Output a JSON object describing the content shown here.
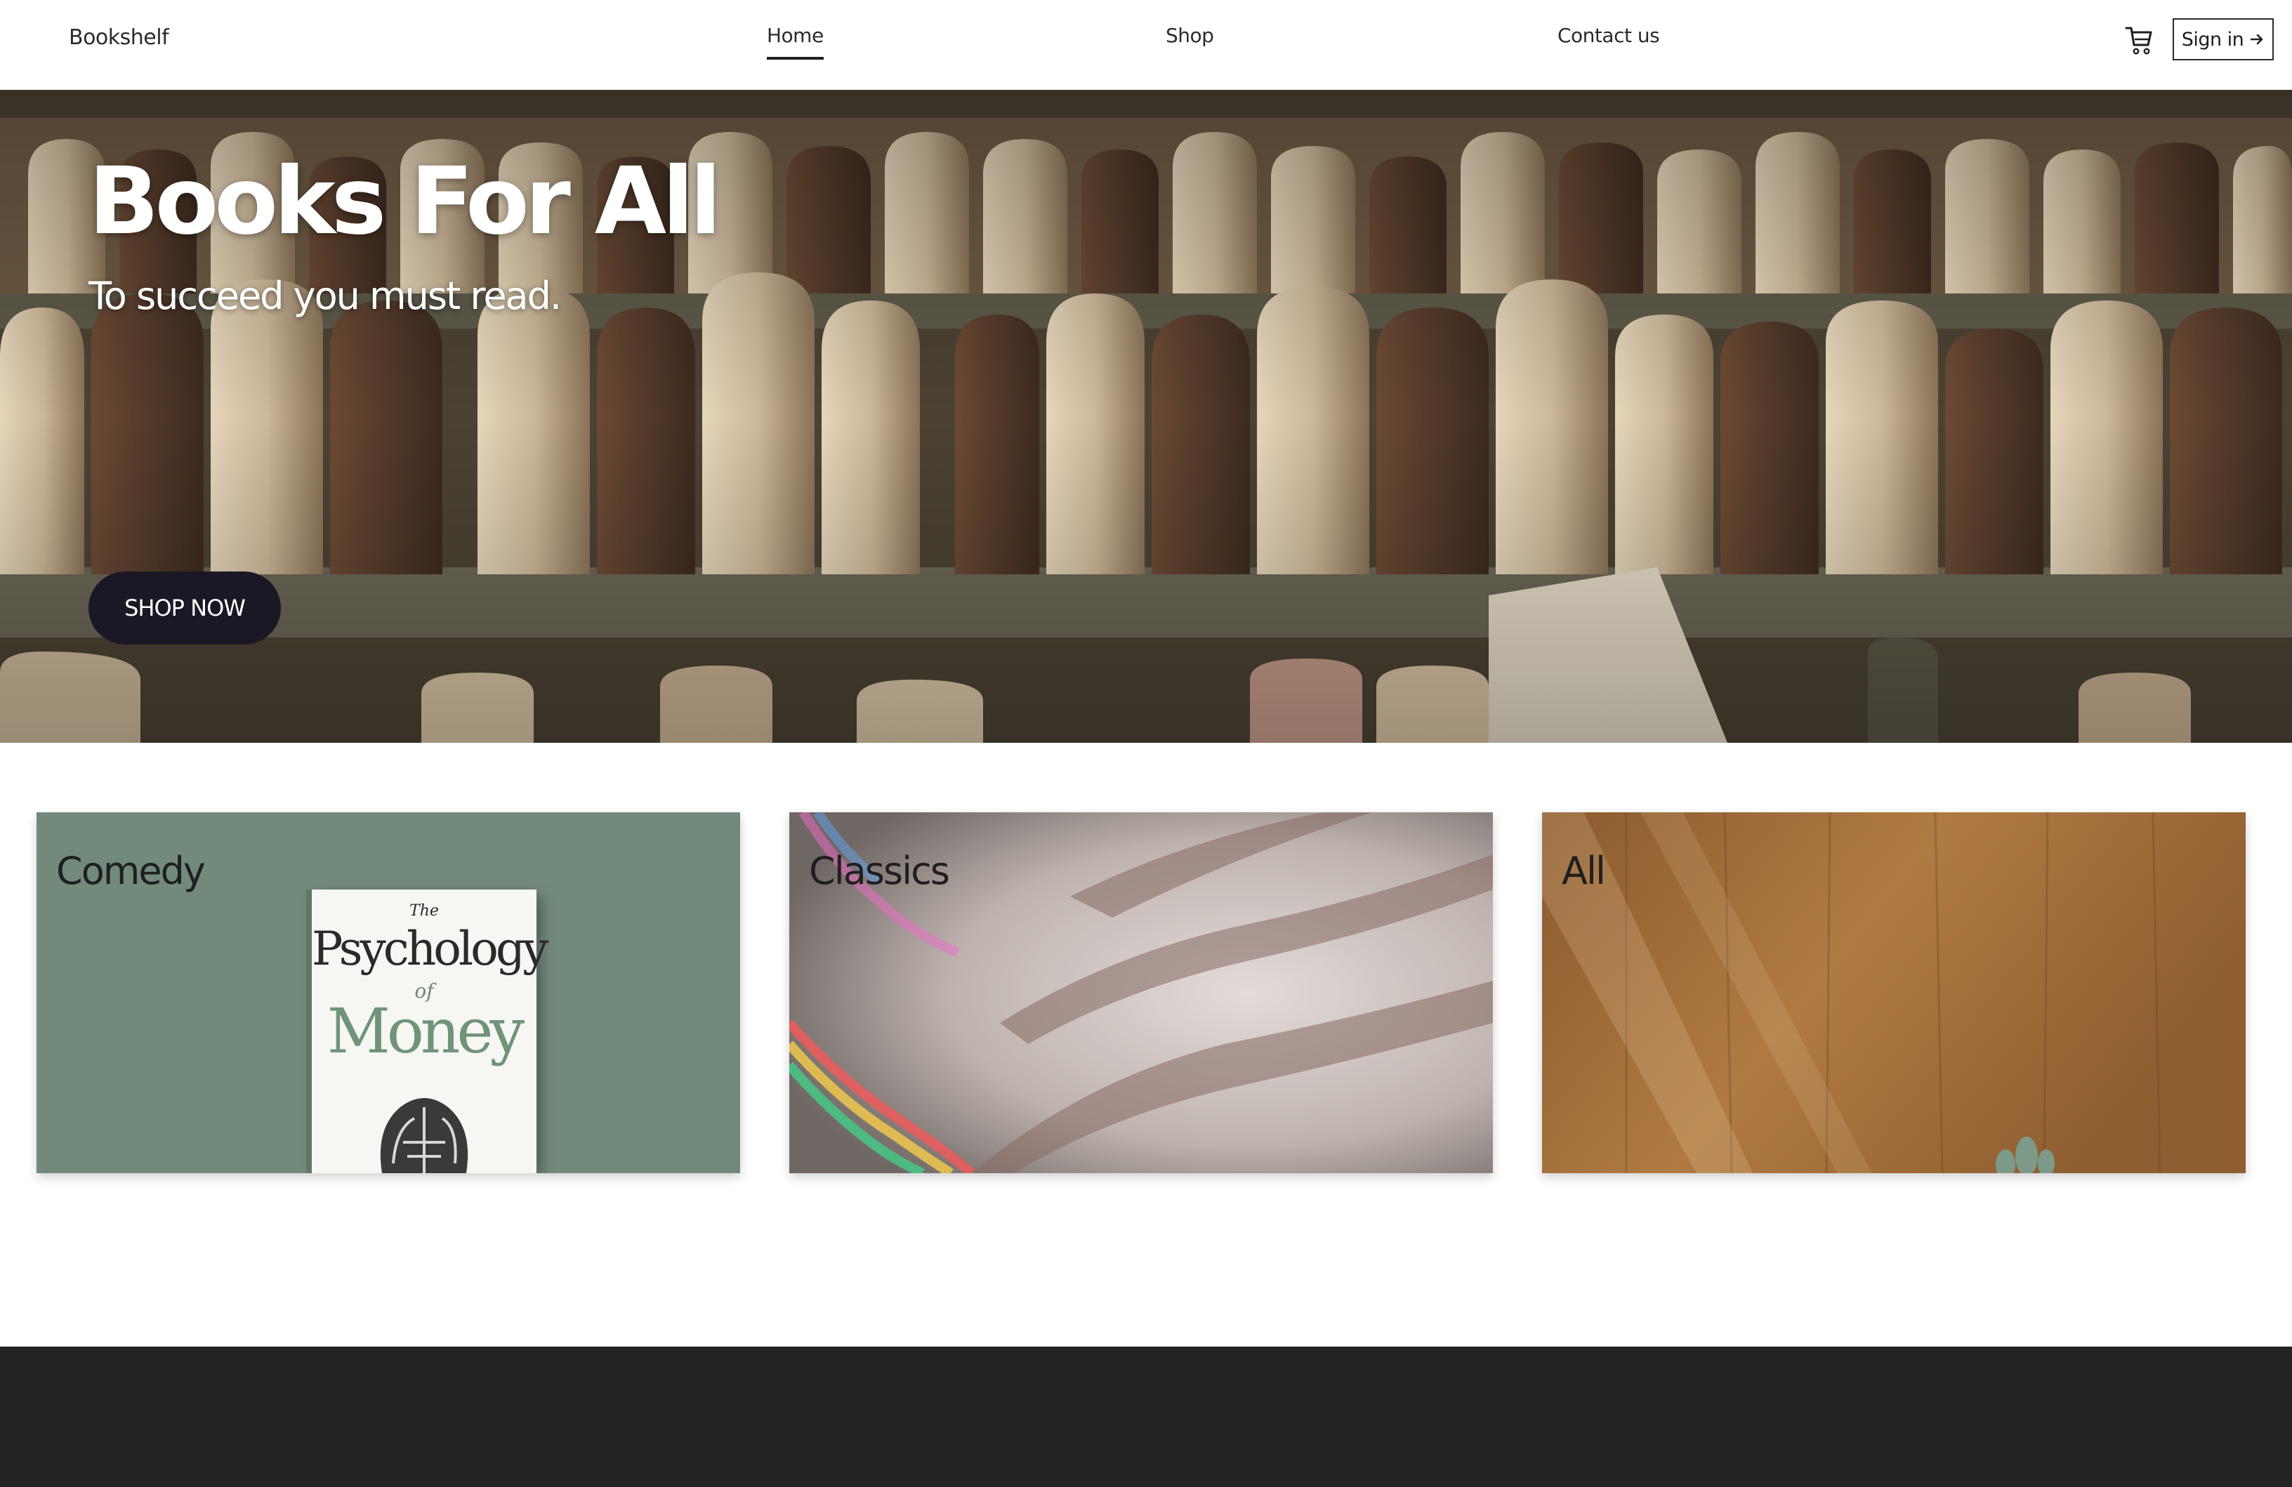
{
  "header": {
    "brand": "Bookshelf",
    "nav": [
      {
        "label": "Home",
        "active": true
      },
      {
        "label": "Shop",
        "active": false
      },
      {
        "label": "Contact us",
        "active": false
      }
    ],
    "cart_icon": "cart-icon",
    "signin_label": "Sign in",
    "signin_icon": "arrow-right-icon"
  },
  "hero": {
    "title": "Books For All",
    "subtitle": "To succeed you must read.",
    "cta_label": "SHOP NOW"
  },
  "categories": [
    {
      "label": "Comedy",
      "color": "#728a7c"
    },
    {
      "label": "Classics",
      "color": "#a5a19c"
    },
    {
      "label": "All",
      "color": "#9a6a3a"
    }
  ],
  "book_cover": {
    "the": "The",
    "line1": "Psychology",
    "of": "of",
    "line2": "Money"
  },
  "colors": {
    "cta_bg": "#1b1725",
    "footer_bg": "#232323"
  }
}
